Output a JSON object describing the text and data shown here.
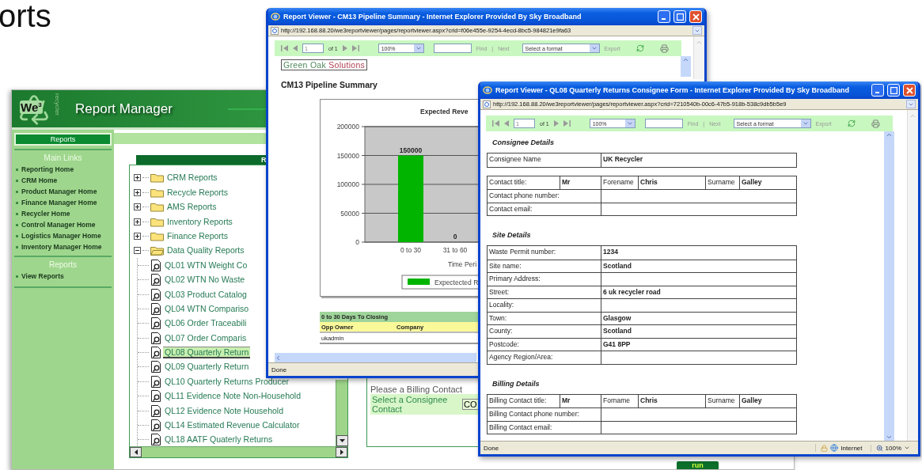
{
  "slide_title": "orts",
  "report_manager": {
    "logo": "We$^{3}$",
    "logo_tagline": "recycler",
    "title": "Report Manager",
    "sidebar": {
      "tab": "Reports",
      "sections": [
        {
          "heading": "Main Links",
          "links": [
            "Reporting Home",
            "CRM Home",
            "Product Manager Home",
            "Finance Manager Home",
            "Recycler Home",
            "Control Manager Home",
            "Logistics Manager Home",
            "Inventory Manager Home"
          ]
        },
        {
          "heading": "Reports",
          "links": [
            "View Reports"
          ]
        }
      ]
    },
    "tree_panel": {
      "title": "R",
      "items": [
        {
          "label": "CRM Reports",
          "expanded": false
        },
        {
          "label": "Recycle Reports",
          "expanded": false
        },
        {
          "label": "AMS Reports",
          "expanded": false
        },
        {
          "label": "Inventory Reports",
          "expanded": false
        },
        {
          "label": "Finance Reports",
          "expanded": false
        },
        {
          "label": "Data Quality Reports",
          "expanded": true,
          "children": [
            {
              "label": "QL01 WTN Weight Co",
              "selected": false
            },
            {
              "label": "QL02 WTN No Waste",
              "selected": false
            },
            {
              "label": "QL03 Product Catalog",
              "selected": false
            },
            {
              "label": "QL04 WTN Compariso",
              "selected": false
            },
            {
              "label": "QL06 Order Traceabili",
              "selected": false
            },
            {
              "label": "QL07 Order Comparis",
              "selected": false
            },
            {
              "label": "QL08 Quarterly Return",
              "selected": true
            },
            {
              "label": "QL09 Quarterly Return",
              "selected": false
            },
            {
              "label": "QL10 Quarterly Returns Producer",
              "selected": false
            },
            {
              "label": "QL11 Evidence Note Non-Household",
              "selected": false
            },
            {
              "label": "QL12 Evidence Note Household",
              "selected": false
            },
            {
              "label": "QL14 Estimated Revenue Calculator",
              "selected": false
            },
            {
              "label": "QL18 AATF Quaterly Returns",
              "selected": false
            }
          ]
        }
      ]
    },
    "billing_panel": {
      "prompt": "Please a Billing Contact",
      "select_label": "Select a Consignee Contact",
      "select_value": "CO"
    },
    "run_button": "run"
  },
  "pipeline_viewer": {
    "title": "Report Viewer - CM13 Pipeline Summary - Internet Explorer Provided By Sky Broadband",
    "address": "http://192.168.88.20/we3reportviewer/pages/reportviewer.aspx?crid=f06e455e-9254-4ecd-8bc5-984821e9fa63",
    "toolbar": {
      "page": "1",
      "page_count": "of 1",
      "zoom": "100%",
      "find": "Find",
      "separator": "|",
      "next": "Next",
      "format": "Select a format",
      "export": "Export"
    },
    "logo_words": [
      "Green Oak",
      "Solutions"
    ],
    "heading": "CM13 Pipeline Summary",
    "chart_data": {
      "type": "bar",
      "title": "Expected Reve",
      "xlabel": "Time Peri",
      "categories": [
        "0 to 30",
        "31 to 60"
      ],
      "series": [
        {
          "name": "Expectected R",
          "color": "#00b400",
          "values": [
            150000,
            0
          ]
        }
      ],
      "ylim": [
        0,
        200000
      ],
      "yticks": [
        0,
        50000,
        100000,
        150000,
        200000
      ],
      "grid": true,
      "data_labels": true
    },
    "table": {
      "title": "0 to 30 Days To Closing",
      "columns": [
        "Opp Owner",
        "Company"
      ],
      "rows": [
        [
          "ukadmin"
        ]
      ]
    },
    "status": {
      "text": "Done"
    }
  },
  "form_viewer": {
    "title": "Report Viewer - QL08 Quarterly Returns Consignee Form - Internet Explorer Provided By Sky Broadband",
    "address": "http://192.168.88.20/we3reportviewer/pages/reportviewer.aspx?crid=7210540b-00c6-47b5-918b-538c9db5b5e9",
    "toolbar": {
      "page": "1",
      "page_count": "of 1",
      "zoom": "100%",
      "find": "Find",
      "separator": "|",
      "next": "Next",
      "format": "Select a format",
      "export": "Export"
    },
    "sections": [
      {
        "heading": "Consignee Details",
        "tables": [
          [
            [
              {
                "text": "Consignee Name",
                "kind": "label"
              },
              {
                "text": "UK Recycler",
                "kind": "value"
              }
            ]
          ],
          [
            [
              {
                "text": "Contact title:",
                "kind": "label"
              },
              {
                "text": "Mr",
                "kind": "value"
              },
              {
                "text": "Forename",
                "kind": "label"
              },
              {
                "text": "Chris",
                "kind": "value"
              },
              {
                "text": "Surname",
                "kind": "label"
              },
              {
                "text": "Galley",
                "kind": "value"
              }
            ],
            [
              {
                "text": "Contact phone number:",
                "kind": "label"
              },
              {
                "kind": "value"
              }
            ],
            [
              {
                "text": "Contact email:",
                "kind": "label"
              },
              {
                "kind": "value"
              }
            ]
          ]
        ]
      },
      {
        "heading": "Site Details",
        "tables": [
          [
            [
              {
                "text": "Waste Permit number:",
                "kind": "label"
              },
              {
                "text": "1234",
                "kind": "value"
              }
            ],
            [
              {
                "text": "Site name:",
                "kind": "label"
              },
              {
                "text": "Scotland",
                "kind": "value"
              }
            ],
            [
              {
                "text": "Primary Address:",
                "kind": "label"
              },
              {
                "kind": "value"
              }
            ],
            [
              {
                "text": "Street:",
                "kind": "label"
              },
              {
                "text": "6 uk recycler road",
                "kind": "value"
              }
            ],
            [
              {
                "text": "Locality:",
                "kind": "label"
              },
              {
                "kind": "value"
              }
            ],
            [
              {
                "text": "Town:",
                "kind": "label"
              },
              {
                "text": "Glasgow",
                "kind": "value"
              }
            ],
            [
              {
                "text": "County:",
                "kind": "label"
              },
              {
                "text": "Scotland",
                "kind": "value"
              }
            ],
            [
              {
                "text": "Postcode:",
                "kind": "label"
              },
              {
                "text": "G41 8PP",
                "kind": "value"
              }
            ],
            [
              {
                "text": "Agency Region/Area:",
                "kind": "label"
              },
              {
                "kind": "value"
              }
            ]
          ]
        ]
      },
      {
        "heading": "Billing Details",
        "tables": [
          [
            [
              {
                "text": "Billing Contact title:",
                "kind": "label"
              },
              {
                "text": "Mr",
                "kind": "value"
              },
              {
                "text": "Forname",
                "kind": "label"
              },
              {
                "text": "Chris",
                "kind": "value"
              },
              {
                "text": "Surname",
                "kind": "label"
              },
              {
                "text": "Galley",
                "kind": "value"
              }
            ],
            [
              {
                "text": "Billing Contact phone number:",
                "kind": "label"
              },
              {
                "kind": "value"
              }
            ],
            [
              {
                "text": "Billing Contact email:",
                "kind": "label"
              },
              {
                "kind": "value"
              }
            ]
          ]
        ]
      }
    ],
    "status": {
      "text": "Done",
      "zone": "Internet",
      "zoom": "100%"
    }
  }
}
